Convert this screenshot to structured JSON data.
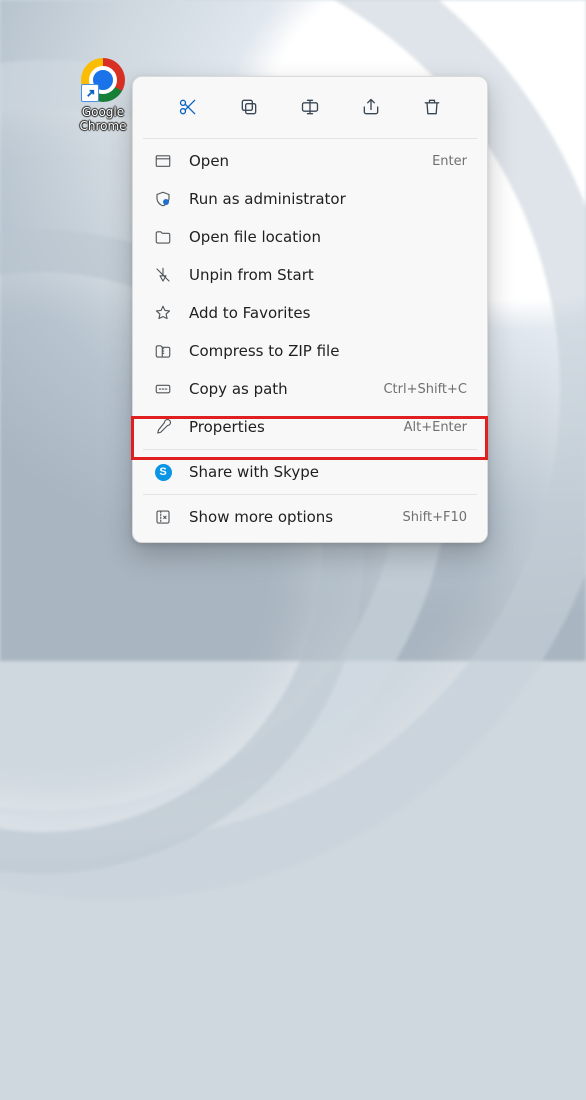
{
  "desktop": {
    "chrome_label": "Google Chrome"
  },
  "toolbar": {
    "cut": "Cut",
    "copy": "Copy",
    "rename": "Rename",
    "share": "Share",
    "delete": "Delete"
  },
  "menu": {
    "open": {
      "label": "Open",
      "accel": "Enter"
    },
    "run_admin": {
      "label": "Run as administrator",
      "accel": ""
    },
    "open_location": {
      "label": "Open file location",
      "accel": ""
    },
    "unpin_start": {
      "label": "Unpin from Start",
      "accel": ""
    },
    "add_favorites": {
      "label": "Add to Favorites",
      "accel": ""
    },
    "compress_zip": {
      "label": "Compress to ZIP file",
      "accel": ""
    },
    "copy_as_path": {
      "label": "Copy as path",
      "accel": "Ctrl+Shift+C"
    },
    "properties": {
      "label": "Properties",
      "accel": "Alt+Enter"
    },
    "share_skype": {
      "label": "Share with Skype",
      "accel": ""
    },
    "show_more": {
      "label": "Show more options",
      "accel": "Shift+F10"
    }
  }
}
